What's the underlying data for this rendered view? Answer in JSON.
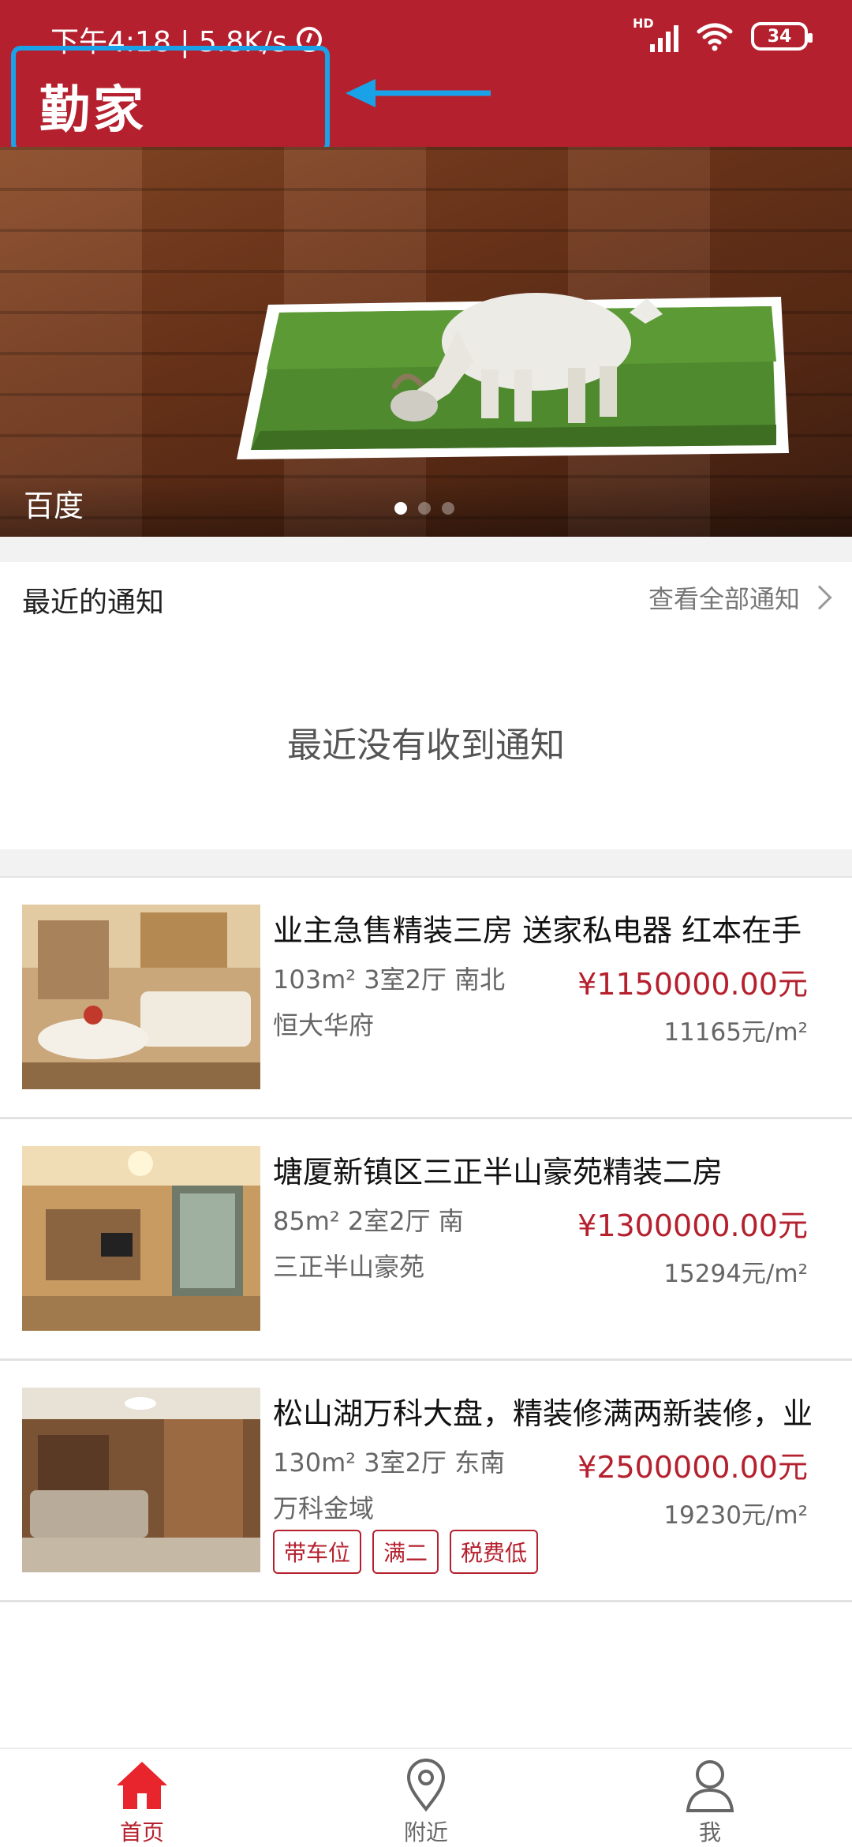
{
  "status_bar": {
    "time_speed": "下午4:18 | 5.8K/s",
    "hd_label": "HD",
    "battery": "34"
  },
  "header": {
    "title": "勤家"
  },
  "banner": {
    "caption": "百度",
    "dots": 3,
    "active_dot": 0
  },
  "notifications": {
    "title": "最近的通知",
    "view_all": "查看全部通知",
    "empty_text": "最近没有收到通知"
  },
  "listings": [
    {
      "title": "业主急售精装三房 送家私电器 红本在手",
      "meta": "103m² 3室2厅 南北",
      "community": "恒大华府",
      "price": "¥1150000.00元",
      "unit_price": "11165元/m²",
      "tags": []
    },
    {
      "title": "塘厦新镇区三正半山豪苑精装二房",
      "meta": "85m² 2室2厅 南",
      "community": "三正半山豪苑",
      "price": "¥1300000.00元",
      "unit_price": "15294元/m²",
      "tags": []
    },
    {
      "title": "松山湖万科大盘，精装修满两新装修，业",
      "meta": "130m² 3室2厅 东南",
      "community": "万科金域",
      "price": "¥2500000.00元",
      "unit_price": "19230元/m²",
      "tags": [
        "带车位",
        "满二",
        "税费低"
      ]
    }
  ],
  "bottom_nav": [
    {
      "label": "首页",
      "icon": "home-icon",
      "active": true
    },
    {
      "label": "附近",
      "icon": "location-pin-icon",
      "active": false
    },
    {
      "label": "我",
      "icon": "user-icon",
      "active": false
    }
  ],
  "colors": {
    "brand_red": "#b5202e",
    "highlight_blue": "#1aa2e8"
  }
}
